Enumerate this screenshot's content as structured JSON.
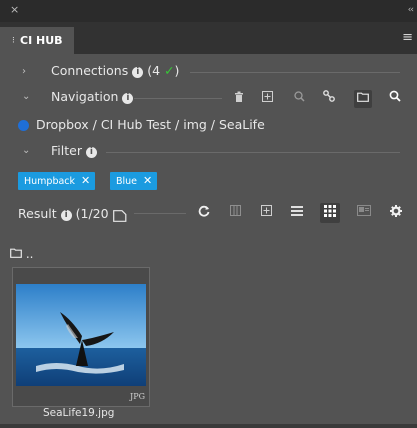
{
  "window": {
    "close_icon": "×",
    "collapse_icon": "‹‹"
  },
  "tab": {
    "label": "CI HUB",
    "grip": "⁝"
  },
  "panel_menu_icon": "≡",
  "connections": {
    "label": "Connections",
    "count_text": "(4",
    "check": "✓",
    "close_paren": ")"
  },
  "navigation": {
    "label": "Navigation"
  },
  "nav_icons": [
    "trash-icon",
    "add-icon",
    "zoom-icon",
    "link-icon",
    "folder-icon",
    "search-icon"
  ],
  "breadcrumb": "Dropbox / CI Hub Test / img / SeaLife",
  "filter": {
    "label": "Filter",
    "tags": [
      {
        "label": "Humpback",
        "remove": "✕"
      },
      {
        "label": "Blue",
        "remove": "✕"
      }
    ]
  },
  "result": {
    "label": "Result",
    "count": "(1/20"
  },
  "result_icons": [
    "refresh-icon",
    "columns-icon",
    "add-icon",
    "list-view-icon",
    "grid-view-icon",
    "thumbnail-icon",
    "settings-icon"
  ],
  "folder_up": "..",
  "file": {
    "name": "SeaLife19.jpg",
    "type": "JPG"
  },
  "colors": {
    "accent": "#1b9be0",
    "panel_bg": "#535353",
    "check": "#37c837",
    "dropbox": "#1f6fd8"
  }
}
